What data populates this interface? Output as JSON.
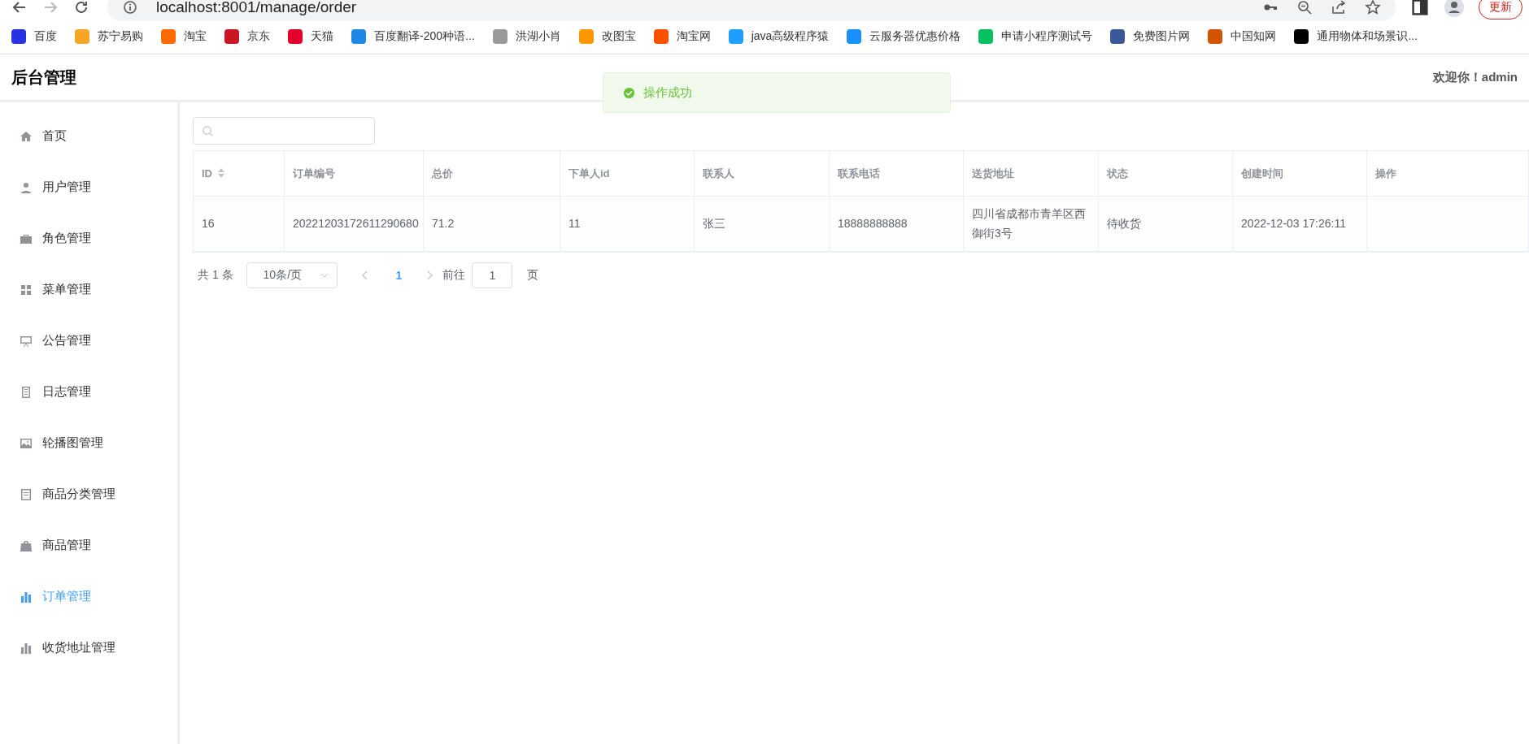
{
  "browser": {
    "url": "localhost:8001/manage/order",
    "update_button": "更新",
    "bookmarks": [
      "百度",
      "苏宁易购",
      "淘宝",
      "京东",
      "天猫",
      "百度翻译-200种语...",
      "洪湖小肖",
      "改图宝",
      "淘宝网",
      "java高级程序猿",
      "云服务器优惠价格",
      "申请小程序测试号",
      "免费图片网",
      "中国知网",
      "通用物体和场景识..."
    ]
  },
  "header": {
    "title": "后台管理",
    "welcome": "欢迎你！admin"
  },
  "toast": {
    "message": "操作成功"
  },
  "sidebar": {
    "items": [
      {
        "label": "首页",
        "selected": false
      },
      {
        "label": "用户管理",
        "selected": false
      },
      {
        "label": "角色管理",
        "selected": false
      },
      {
        "label": "菜单管理",
        "selected": false
      },
      {
        "label": "公告管理",
        "selected": false
      },
      {
        "label": "日志管理",
        "selected": false
      },
      {
        "label": "轮播图管理",
        "selected": false
      },
      {
        "label": "商品分类管理",
        "selected": false
      },
      {
        "label": "商品管理",
        "selected": false
      },
      {
        "label": "订单管理",
        "selected": true
      },
      {
        "label": "收货地址管理",
        "selected": false
      }
    ]
  },
  "table": {
    "columns": [
      {
        "label": "ID",
        "sortable": true
      },
      {
        "label": "订单编号",
        "sortable": false
      },
      {
        "label": "总价",
        "sortable": false
      },
      {
        "label": "下单人id",
        "sortable": false
      },
      {
        "label": "联系人",
        "sortable": false
      },
      {
        "label": "联系电话",
        "sortable": false
      },
      {
        "label": "送货地址",
        "sortable": false
      },
      {
        "label": "状态",
        "sortable": false
      },
      {
        "label": "创建时间",
        "sortable": false
      },
      {
        "label": "操作",
        "sortable": false
      }
    ],
    "rows": [
      [
        "16",
        "20221203172611290680",
        "71.2",
        "11",
        "张三",
        "18888888888",
        "四川省成都市青羊区西御街3号",
        "待收货",
        "2022-12-03 17:26:11",
        ""
      ]
    ]
  },
  "pagination": {
    "total": "共 1 条",
    "page_size": "10条/页",
    "pages": [
      {
        "label": "1",
        "selected": true
      }
    ],
    "goto_label": "前往",
    "goto_value": "1",
    "goto_suffix": "页"
  }
}
